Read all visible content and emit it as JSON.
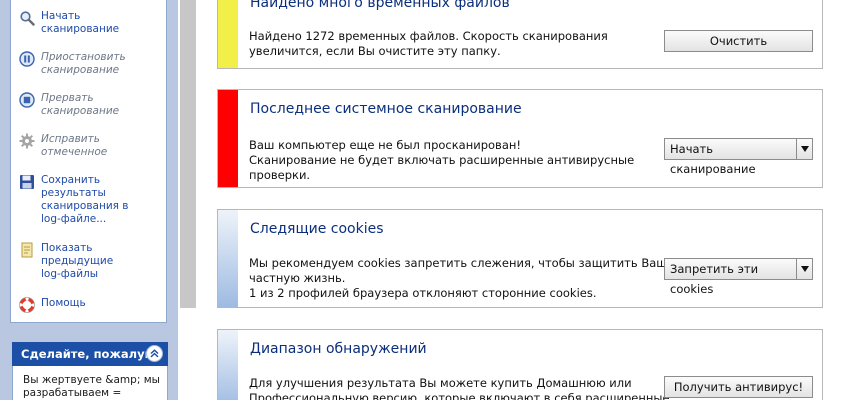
{
  "sidebar": {
    "tasks": [
      {
        "label": "Начать\nсканирование",
        "icon": "magnifier-icon",
        "disabled": false
      },
      {
        "label": "Приостановить\nсканирование",
        "icon": "pause-icon",
        "disabled": true
      },
      {
        "label": "Прервать\nсканирование",
        "icon": "stop-icon",
        "disabled": true
      },
      {
        "label": "Исправить\nотмеченное",
        "icon": "gear-icon",
        "disabled": true
      },
      {
        "label": "Сохранить\nрезультаты\nсканирования в\nlog-файле...",
        "icon": "floppy-disk-icon",
        "disabled": false
      },
      {
        "label": "Показать\nпредыдущие\nlog-файлы",
        "icon": "log-file-icon",
        "disabled": false
      },
      {
        "label": "Помощь",
        "icon": "lifebuoy-icon",
        "disabled": false
      }
    ],
    "donate": {
      "title": "Сделайте, пожалуйс",
      "text": "Вы жертвуете &amp; мы\nразрабатываем ="
    }
  },
  "panels": [
    {
      "title": "Найдено много временных файлов",
      "text": "Найдено 1272 временных файлов. Скорость сканирования\nувеличится, если Вы очистите эту папку.",
      "button": "Очистить",
      "stripe_color": "#f2f048"
    },
    {
      "title": "Последнее системное сканирование",
      "text": "Ваш компьютер еще не был просканирован!\nСканирование не будет включать расширенные антивирусные\nпроверки.",
      "button": "Начать сканирование",
      "stripe_color": "#ff0000"
    },
    {
      "title": "Следящие cookies",
      "text": "Мы рекомендуем cookies запретить слежения, чтобы защитить Вашу\nчастную жизнь.\n1 из 2 профилей браузера отклоняют сторонние cookies.",
      "button": "Запретить эти cookies",
      "stripe_color": "#9ebbe2"
    },
    {
      "title": "Диапазон обнаружений",
      "text": "Для улучшения результата Вы можете купить Домашнюю или\nПрофессиональную версию, которые включают в себя расширенные",
      "button": "Получить антивирус!",
      "stripe_color": "#9ebbe2"
    }
  ]
}
